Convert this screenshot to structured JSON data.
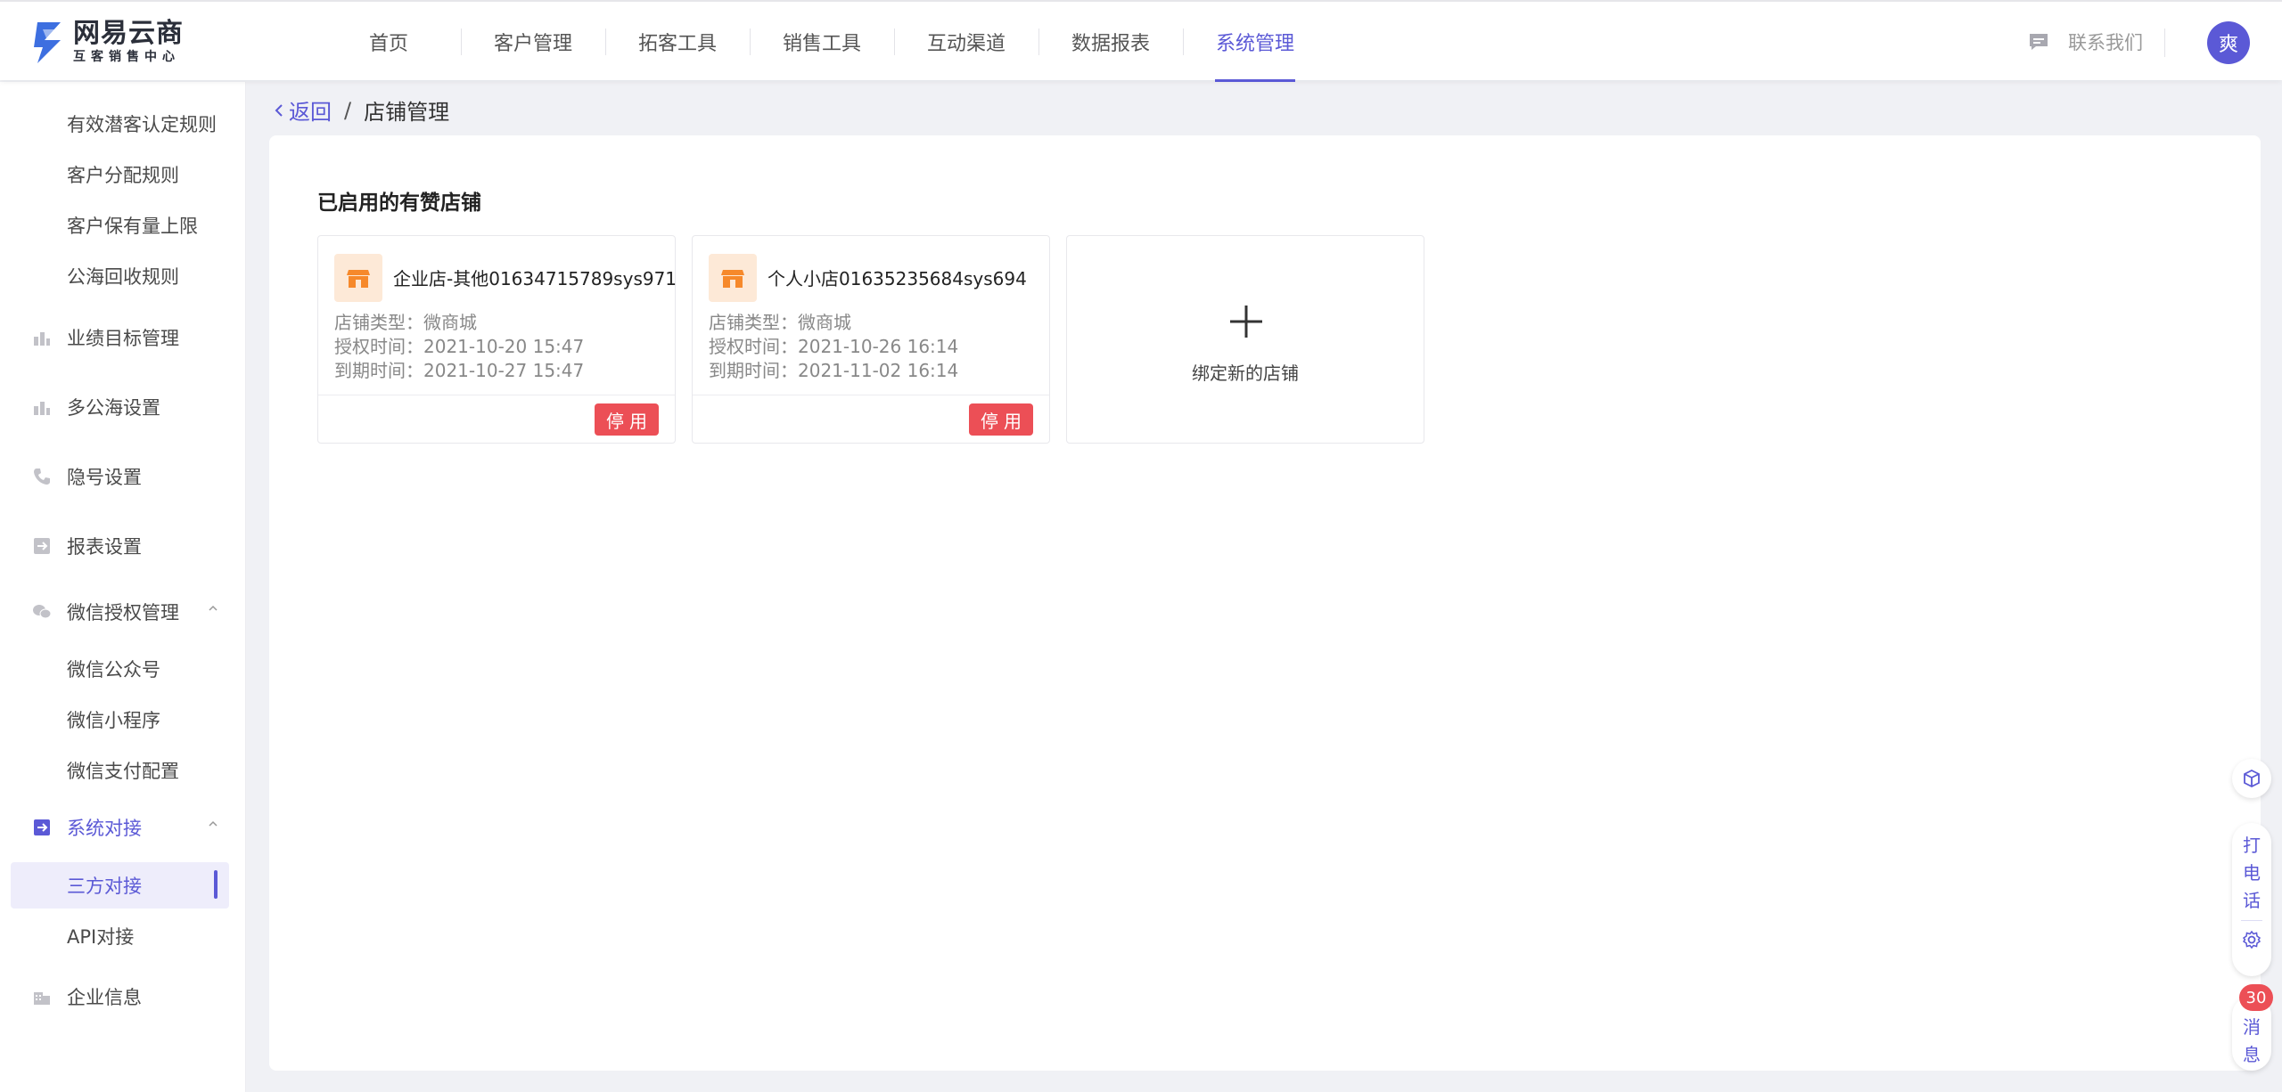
{
  "header": {
    "logo_title": "网易云商",
    "logo_subtitle": "互客销售中心",
    "nav": [
      {
        "label": "首页"
      },
      {
        "label": "客户管理"
      },
      {
        "label": "拓客工具"
      },
      {
        "label": "销售工具"
      },
      {
        "label": "互动渠道"
      },
      {
        "label": "数据报表"
      },
      {
        "label": "系统管理",
        "active": true
      }
    ],
    "contact_label": "联系我们",
    "avatar_text": "爽",
    "accent_color": "#5b59d6"
  },
  "sidebar": {
    "top_subitems": [
      "有效潜客认定规则",
      "客户分配规则",
      "客户保有量上限",
      "公海回收规则"
    ],
    "groups": {
      "performance": "业绩目标管理",
      "multi_sea": "多公海设置",
      "hidden_number": "隐号设置",
      "report": "报表设置",
      "wechat": "微信授权管理",
      "system": "系统对接",
      "enterprise": "企业信息"
    },
    "wechat_items": [
      "微信公众号",
      "微信小程序",
      "微信支付配置"
    ],
    "system_items": [
      "三方对接",
      "API对接"
    ],
    "active_item": "三方对接"
  },
  "breadcrumb": {
    "back_label": "返回",
    "separator": "/",
    "current": "店铺管理"
  },
  "main": {
    "section_title": "已启用的有赞店铺",
    "shops": [
      {
        "name": "企业店-其他01634715789sys971",
        "type_label": "店铺类型：",
        "type_value": "微商城",
        "auth_label": "授权时间：",
        "auth_value": "2021-10-20 15:47",
        "expire_label": "到期时间：",
        "expire_value": "2021-10-27 15:47",
        "stop_label": "停用"
      },
      {
        "name": "个人小店01635235684sys694",
        "type_label": "店铺类型：",
        "type_value": "微商城",
        "auth_label": "授权时间：",
        "auth_value": "2021-10-26 16:14",
        "expire_label": "到期时间：",
        "expire_value": "2021-11-02 16:14",
        "stop_label": "停用"
      }
    ],
    "add_label": "绑定新的店铺"
  },
  "float_tools": {
    "call_chars": [
      "打",
      "电",
      "话"
    ],
    "message_chars": [
      "消",
      "息"
    ],
    "message_count": "30"
  },
  "colors": {
    "danger": "#ec4f56",
    "shop_icon_bg": "#fde9d7",
    "shop_icon_fg": "#f6892b"
  }
}
